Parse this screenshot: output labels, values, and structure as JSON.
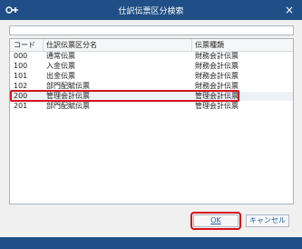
{
  "window": {
    "title": "仕訳伝票区分検索",
    "icon": "key-plus-icon",
    "close": "×"
  },
  "search": {
    "value": ""
  },
  "table": {
    "headers": [
      "コード",
      "仕訳伝票区分名",
      "伝票種類"
    ],
    "rows": [
      [
        "000",
        "通常伝票",
        "財務会計伝票"
      ],
      [
        "100",
        "入金伝票",
        "財務会計伝票"
      ],
      [
        "101",
        "出金伝票",
        "財務会計伝票"
      ],
      [
        "102",
        "部門配賦伝票",
        "財務会計伝票"
      ],
      [
        "200",
        "管理会計伝票",
        "管理会計伝票"
      ],
      [
        "201",
        "部門配賦伝票",
        "管理会計伝票"
      ]
    ],
    "selected_index": 4
  },
  "buttons": {
    "ok": "OK",
    "cancel": "キャンセル"
  },
  "colors": {
    "titlebar": "#1f4f86",
    "highlight": "#d6121b",
    "link_text": "#2361b0"
  }
}
